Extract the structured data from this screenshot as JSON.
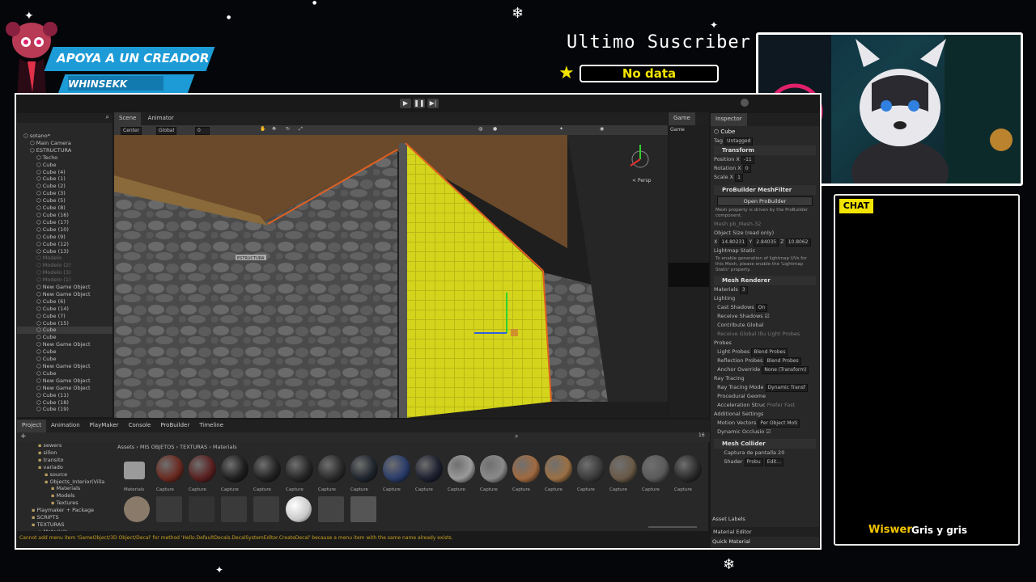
{
  "overlay": {
    "banner_title": "APOYA A UN CREADOR",
    "banner_name": "WHINSEKK",
    "subscriber_title": "Ultimo Suscriber",
    "subscriber_value": "No data",
    "chat_label": "CHAT",
    "chat_user": "Wiswer",
    "chat_message": "Gris y gris",
    "accent_yellow": "#f2e400",
    "accent_blue": "#1d9bd6"
  },
  "unity": {
    "scene_tabs": [
      "Scene",
      "Animator"
    ],
    "game_tab": "Game",
    "game_label": "Game",
    "scene_toolbar": {
      "pivot": "Center",
      "space": "Global",
      "value": "0"
    },
    "persp_label": "< Persp",
    "scene_label": "ESTRUCTURA",
    "hierarchy": [
      {
        "label": "sotano*",
        "indent": 1,
        "dim": false
      },
      {
        "label": "Main Camera",
        "indent": 2,
        "dim": false
      },
      {
        "label": "ESTRUCTURA",
        "indent": 2,
        "dim": false
      },
      {
        "label": "Techo",
        "indent": 3,
        "dim": false
      },
      {
        "label": "Cube",
        "indent": 3,
        "dim": false
      },
      {
        "label": "Cube (4)",
        "indent": 3,
        "dim": false
      },
      {
        "label": "Cube (1)",
        "indent": 3,
        "dim": false
      },
      {
        "label": "Cube (2)",
        "indent": 3,
        "dim": false
      },
      {
        "label": "Cube (3)",
        "indent": 3,
        "dim": false
      },
      {
        "label": "Cube (5)",
        "indent": 3,
        "dim": false
      },
      {
        "label": "Cube (8)",
        "indent": 3,
        "dim": false
      },
      {
        "label": "Cube (16)",
        "indent": 3,
        "dim": false
      },
      {
        "label": "Cube (17)",
        "indent": 3,
        "dim": false
      },
      {
        "label": "Cube (10)",
        "indent": 3,
        "dim": false
      },
      {
        "label": "Cube (9)",
        "indent": 3,
        "dim": false
      },
      {
        "label": "Cube (12)",
        "indent": 3,
        "dim": false
      },
      {
        "label": "Cube (13)",
        "indent": 3,
        "dim": false
      },
      {
        "label": "Modelo",
        "indent": 3,
        "dim": true
      },
      {
        "label": "Modelo (2)",
        "indent": 3,
        "dim": true
      },
      {
        "label": "Modelo (3)",
        "indent": 3,
        "dim": true
      },
      {
        "label": "Modelo (1)",
        "indent": 3,
        "dim": true
      },
      {
        "label": "New Game Object",
        "indent": 3,
        "dim": false
      },
      {
        "label": "New Game Object",
        "indent": 3,
        "dim": false
      },
      {
        "label": "Cube (6)",
        "indent": 3,
        "dim": false
      },
      {
        "label": "Cube (14)",
        "indent": 3,
        "dim": false
      },
      {
        "label": "Cube (7)",
        "indent": 3,
        "dim": false
      },
      {
        "label": "Cube (15)",
        "indent": 3,
        "dim": false
      },
      {
        "label": "Cube",
        "indent": 3,
        "dim": false,
        "selected": true
      },
      {
        "label": "Cube",
        "indent": 3,
        "dim": false
      },
      {
        "label": "New Game Object",
        "indent": 3,
        "dim": false
      },
      {
        "label": "Cube",
        "indent": 3,
        "dim": false
      },
      {
        "label": "Cube",
        "indent": 3,
        "dim": false
      },
      {
        "label": "New Game Object",
        "indent": 3,
        "dim": false
      },
      {
        "label": "Cube",
        "indent": 3,
        "dim": false
      },
      {
        "label": "New Game Object",
        "indent": 3,
        "dim": false
      },
      {
        "label": "New Game Object",
        "indent": 3,
        "dim": false
      },
      {
        "label": "Cube (11)",
        "indent": 3,
        "dim": false
      },
      {
        "label": "Cube (18)",
        "indent": 3,
        "dim": false
      },
      {
        "label": "Cube (19)",
        "indent": 3,
        "dim": false
      }
    ],
    "inspector": {
      "tab": "Inspector",
      "object_name": "Cube",
      "tag_label": "Tag",
      "tag_value": "Untagged",
      "transform": "Transform",
      "position_label": "Position",
      "position_x": "-11",
      "rotation_label": "Rotation",
      "rotation_x": "0",
      "scale_label": "Scale",
      "scale_x": "1",
      "meshfilter": "ProBuilder MeshFilter",
      "open_probuilder": "Open ProBuilder",
      "meshfilter_note": "Mesh property is driven by the ProBuilder component.",
      "mesh_label": "Mesh",
      "mesh_value": "pb_Mesh-32",
      "object_size_label": "Object Size (read only)",
      "size_x": "14.80231",
      "size_y": "2.84035",
      "size_z": "10.8062",
      "lightmap_label": "Lightmap Static",
      "lightmap_note": "To enable generation of lightmap UVs for this Mesh, please enable the 'Lightmap Static' property.",
      "mesh_renderer": "Mesh Renderer",
      "materials_label": "Materials",
      "materials_count": "3",
      "lighting_label": "Lighting",
      "cast_shadows_label": "Cast Shadows",
      "cast_shadows_value": "On",
      "receive_shadows_label": "Receive Shadows",
      "contribute_gi_label": "Contribute Global",
      "receive_gi_label": "Receive Global Illu",
      "receive_gi_value": "Light Probes",
      "probes_label": "Probes",
      "light_probes_label": "Light Probes",
      "light_probes_value": "Blend Probes",
      "reflection_probes_label": "Reflection Probes",
      "reflection_probes_value": "Blend Probes",
      "anchor_override_label": "Anchor Override",
      "anchor_override_value": "None (Transform)",
      "ray_tracing_label": "Ray Tracing",
      "ray_tracing_mode_label": "Ray Tracing Mode",
      "ray_tracing_mode_value": "Dynamic Transf",
      "procedural_geom_label": "Procedural Geome",
      "acceleration_label": "Acceleration Struc",
      "acceleration_value": "Prefer Fast",
      "additional_label": "Additional Settings",
      "motion_vectors_label": "Motion Vectors",
      "motion_vectors_value": "Per Object Moti",
      "dynamic_occlusion_label": "Dynamic Occlusio",
      "mesh_collider": "Mesh Collider",
      "material_name": "Captura de pantalla 20",
      "shader_label": "Shader",
      "shader_value": "Probu",
      "edit_label": "Edit...",
      "asset_labels": "Asset Labels",
      "material_editor": "Material Editor",
      "quick_material": "Quick Material"
    },
    "bottom_tabs": [
      "Project",
      "Animation",
      "PlayMaker",
      "Console",
      "ProBuilder",
      "Timeline"
    ],
    "breadcrumb": [
      "Assets",
      "MIS OBJETOS",
      "TEXTURAS",
      "Materials"
    ],
    "project_tree": [
      {
        "label": "sewers",
        "indent": 1
      },
      {
        "label": "sillon",
        "indent": 1
      },
      {
        "label": "transito",
        "indent": 1
      },
      {
        "label": "variado",
        "indent": 1
      },
      {
        "label": "source",
        "indent": 2
      },
      {
        "label": "Objects_Interior(Villa",
        "indent": 2
      },
      {
        "label": "Materials",
        "indent": 3
      },
      {
        "label": "Models",
        "indent": 3
      },
      {
        "label": "Textures",
        "indent": 3
      },
      {
        "label": "Playmaker + Package",
        "indent": 0
      },
      {
        "label": "SCRIPTS",
        "indent": 0
      },
      {
        "label": "TEXTURAS",
        "indent": 0
      },
      {
        "label": "Materials",
        "indent": 1
      }
    ],
    "assets_row1": [
      {
        "label": "Materials",
        "color": "#9a9a9a",
        "folder": true
      },
      {
        "label": "Capture",
        "color": "#6a2a20"
      },
      {
        "label": "Capture",
        "color": "#5a2020"
      },
      {
        "label": "Capture",
        "color": "#1e1e1e"
      },
      {
        "label": "Capture",
        "color": "#222222"
      },
      {
        "label": "Capture",
        "color": "#262626"
      },
      {
        "label": "Capture",
        "color": "#2a2a2a"
      },
      {
        "label": "Capture",
        "color": "#20262e"
      },
      {
        "label": "Capture",
        "color": "#2a3c6a"
      },
      {
        "label": "Capture",
        "color": "#1e2030"
      },
      {
        "label": "Capture",
        "color": "#9a9a9a"
      },
      {
        "label": "Capture",
        "color": "#8a8a8a"
      },
      {
        "label": "Capture",
        "color": "#a06a40"
      },
      {
        "label": "Capture",
        "color": "#9a7044"
      },
      {
        "label": "Capture",
        "color": "#3a3a3a"
      },
      {
        "label": "Capture",
        "color": "#6a5a48"
      },
      {
        "label": "Capture",
        "color": "#5a5a5a"
      },
      {
        "label": "Capture",
        "color": "#2a2a2a"
      }
    ],
    "assets_row2_colors": [
      "#8a7a6a",
      "#3a3a3a",
      "#333333",
      "#3a3a3a",
      "#3c3c3c",
      "#c8c8c8",
      "#444444",
      "#555555"
    ],
    "zoom_value": "16",
    "status": "Cannot add menu item 'GameObject/3D Object/Decal' for method 'Hello.DefaultDecals.DecalSystemEditor.CreateDecal' because a menu item with the same name already exists."
  }
}
